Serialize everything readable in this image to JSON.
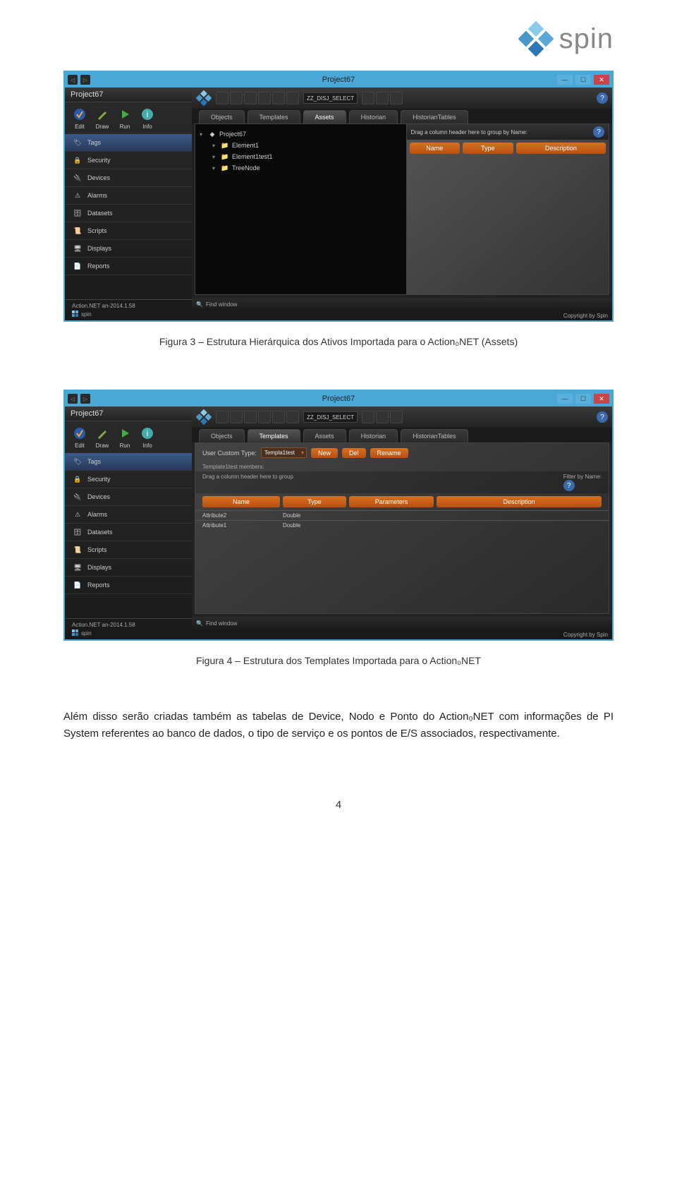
{
  "logo": {
    "text": "spin"
  },
  "win1": {
    "title": "Project67",
    "project_name": "Project67",
    "version": "Action.NET an-2014.1.58",
    "version_brand": "spin",
    "main_icons": [
      {
        "label": "Edit"
      },
      {
        "label": "Draw"
      },
      {
        "label": "Run"
      },
      {
        "label": "Info"
      }
    ],
    "nav": [
      {
        "label": "Tags"
      },
      {
        "label": "Security"
      },
      {
        "label": "Devices"
      },
      {
        "label": "Alarms"
      },
      {
        "label": "Datasets"
      },
      {
        "label": "Scripts"
      },
      {
        "label": "Displays"
      },
      {
        "label": "Reports"
      }
    ],
    "toolbar_combo": "ZZ_DISJ_SELECT",
    "tabs": [
      {
        "label": "Objects"
      },
      {
        "label": "Templates"
      },
      {
        "label": "Assets"
      },
      {
        "label": "Historian"
      },
      {
        "label": "HistorianTables"
      }
    ],
    "active_tab_index": 2,
    "tree": [
      {
        "label": "Project67",
        "level": 0
      },
      {
        "label": "Element1",
        "level": 1
      },
      {
        "label": "Element1test1",
        "level": 1
      },
      {
        "label": "TreeNode",
        "level": 1
      }
    ],
    "grid_hint": "Drag a column header here to group by Name:",
    "grid_cols": [
      "Name",
      "Type",
      "Description"
    ],
    "find_label": "Find window",
    "copyright": "Copyright by Spin"
  },
  "caption1": "Figura 3 – Estrutura Hierárquica dos Ativos Importada para o Action₀NET (Assets)",
  "win2": {
    "title": "Project67",
    "project_name": "Project67",
    "version": "Action.NET an-2014.1.58",
    "version_brand": "spin",
    "main_icons": [
      {
        "label": "Edit"
      },
      {
        "label": "Draw"
      },
      {
        "label": "Run"
      },
      {
        "label": "Info"
      }
    ],
    "nav": [
      {
        "label": "Tags"
      },
      {
        "label": "Security"
      },
      {
        "label": "Devices"
      },
      {
        "label": "Alarms"
      },
      {
        "label": "Datasets"
      },
      {
        "label": "Scripts"
      },
      {
        "label": "Displays"
      },
      {
        "label": "Reports"
      }
    ],
    "toolbar_combo": "ZZ_DISJ_SELECT",
    "tabs": [
      {
        "label": "Objects"
      },
      {
        "label": "Templates"
      },
      {
        "label": "Assets"
      },
      {
        "label": "Historian"
      },
      {
        "label": "HistorianTables"
      }
    ],
    "active_tab_index": 1,
    "type_label": "User Custom Type:",
    "type_value": "Templa1test",
    "btn_new": "New",
    "btn_del": "Del",
    "btn_rename": "Rename",
    "members_label": "Template1test  members:",
    "group_hint": "Drag a column header here to group",
    "filter_label": "Filter by Name:",
    "cols": [
      "Name",
      "Type",
      "Parameters",
      "Description"
    ],
    "rows": [
      {
        "name": "Attribute2",
        "type": "Double",
        "param": "",
        "desc": ""
      },
      {
        "name": "Attribute1",
        "type": "Double",
        "param": "",
        "desc": ""
      }
    ],
    "find_label": "Find window",
    "copyright": "Copyright by Spin"
  },
  "caption2": "Figura 4 – Estrutura dos Templates Importada para o Action₀NET",
  "body_text": "Além disso serão criadas também as tabelas de Device, Nodo e Ponto do Action₀NET com informações de PI System referentes ao banco de dados, o tipo de serviço e os pontos de E/S associados, respectivamente.",
  "page_number": "4"
}
